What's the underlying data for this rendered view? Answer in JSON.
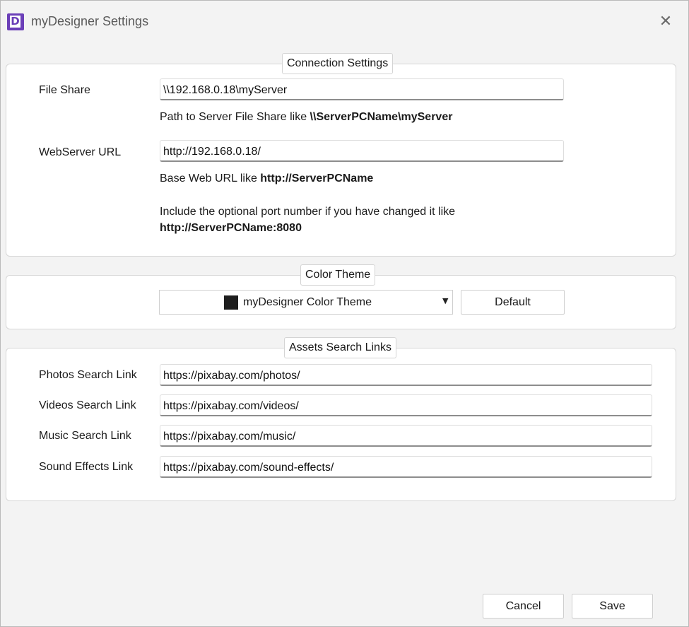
{
  "window": {
    "title": "myDesigner Settings",
    "icon": "mydesigner-app-icon",
    "icon_letter": "D",
    "close_label": "✕"
  },
  "connection": {
    "legend": "Connection Settings",
    "file_share": {
      "label": "File Share",
      "value": "\\\\192.168.0.18\\myServer",
      "hint_prefix": "Path to Server File Share like ",
      "hint_bold": "\\\\ServerPCName\\myServer"
    },
    "webserver": {
      "label": "WebServer URL",
      "value": "http://192.168.0.18/",
      "hint_prefix": "Base Web URL like ",
      "hint_bold": "http://ServerPCName",
      "port_hint": "Include the optional port number if you have changed it like",
      "port_example": "http://ServerPCName:8080"
    }
  },
  "color_theme": {
    "legend": "Color Theme",
    "selected": "myDesigner Color Theme",
    "swatch_color": "#1e1e1e",
    "default_button": "Default"
  },
  "assets": {
    "legend": "Assets Search Links",
    "rows": [
      {
        "label": "Photos Search Link",
        "value": "https://pixabay.com/photos/"
      },
      {
        "label": "Videos Search Link",
        "value": "https://pixabay.com/videos/"
      },
      {
        "label": "Music Search Link",
        "value": "https://pixabay.com/music/"
      },
      {
        "label": "Sound Effects Link",
        "value": "https://pixabay.com/sound-effects/"
      }
    ]
  },
  "footer": {
    "cancel": "Cancel",
    "save": "Save"
  }
}
